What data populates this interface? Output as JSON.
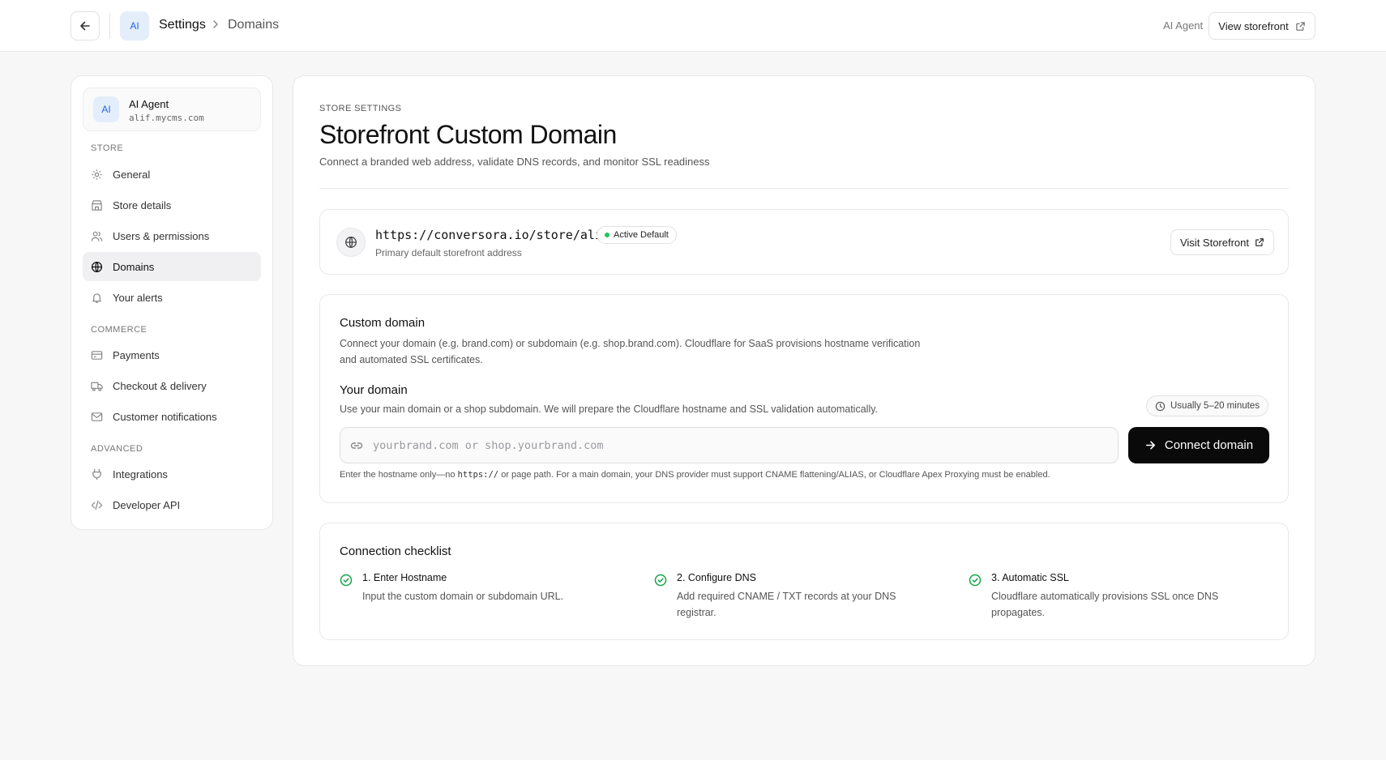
{
  "header": {
    "avatar_initials": "AI",
    "title": "Settings",
    "breadcrumb_current": "Domains",
    "user_label": "AI Agent",
    "view_storefront_label": "View storefront"
  },
  "sidebar": {
    "account": {
      "initials": "AI",
      "name": "AI Agent",
      "host": "alif.mycms.com"
    },
    "sections": [
      {
        "label": "STORE",
        "items": [
          {
            "label": "General",
            "icon": "gear-icon"
          },
          {
            "label": "Store details",
            "icon": "store-icon"
          },
          {
            "label": "Users & permissions",
            "icon": "users-icon"
          },
          {
            "label": "Domains",
            "icon": "globe-icon",
            "active": true
          },
          {
            "label": "Your alerts",
            "icon": "bell-icon"
          }
        ]
      },
      {
        "label": "COMMERCE",
        "items": [
          {
            "label": "Payments",
            "icon": "credit-card-icon"
          },
          {
            "label": "Checkout & delivery",
            "icon": "truck-icon"
          },
          {
            "label": "Customer notifications",
            "icon": "mail-icon"
          }
        ]
      },
      {
        "label": "ADVANCED",
        "items": [
          {
            "label": "Integrations",
            "icon": "plug-icon"
          },
          {
            "label": "Developer API",
            "icon": "code-icon"
          }
        ]
      }
    ]
  },
  "main": {
    "eyebrow": "STORE SETTINGS",
    "title": "Storefront Custom Domain",
    "description": "Connect a branded web address, validate DNS records, and monitor SSL readiness",
    "default_domain": {
      "url": "https://conversora.io/store/alif",
      "badge": "Active Default",
      "subtitle": "Primary default storefront address",
      "visit_label": "Visit Storefront"
    },
    "custom_domain": {
      "title": "Custom domain",
      "description": "Connect your domain (e.g. brand.com) or subdomain (e.g. shop.brand.com). Cloudflare for SaaS provisions hostname verification and automated SSL certificates.",
      "your_domain_title": "Your domain",
      "your_domain_desc": "Use your main domain or a shop subdomain. We will prepare the Cloudflare hostname and SSL validation automatically.",
      "time_estimate": "Usually 5–20 minutes",
      "input_value": "",
      "input_placeholder": "yourbrand.com or shop.yourbrand.com",
      "connect_label": "Connect domain",
      "hint_prefix": "Enter the hostname only—no",
      "hint_code": "https://",
      "hint_suffix": "or page path. For a main domain, your DNS provider must support CNAME flattening/ALIAS, or Cloudflare Apex Proxying must be enabled."
    },
    "checklist": {
      "title": "Connection checklist",
      "steps": [
        {
          "title": "1. Enter Hostname",
          "desc": "Input the custom domain or subdomain URL."
        },
        {
          "title": "2. Configure DNS",
          "desc": "Add required CNAME / TXT records at your DNS registrar."
        },
        {
          "title": "3. Automatic SSL",
          "desc": "Cloudflare automatically provisions SSL once DNS propagates."
        }
      ]
    }
  },
  "colors": {
    "accent_blue": "#2563eb",
    "success_green": "#22c55e",
    "primary_button": "#0a0a0a"
  }
}
